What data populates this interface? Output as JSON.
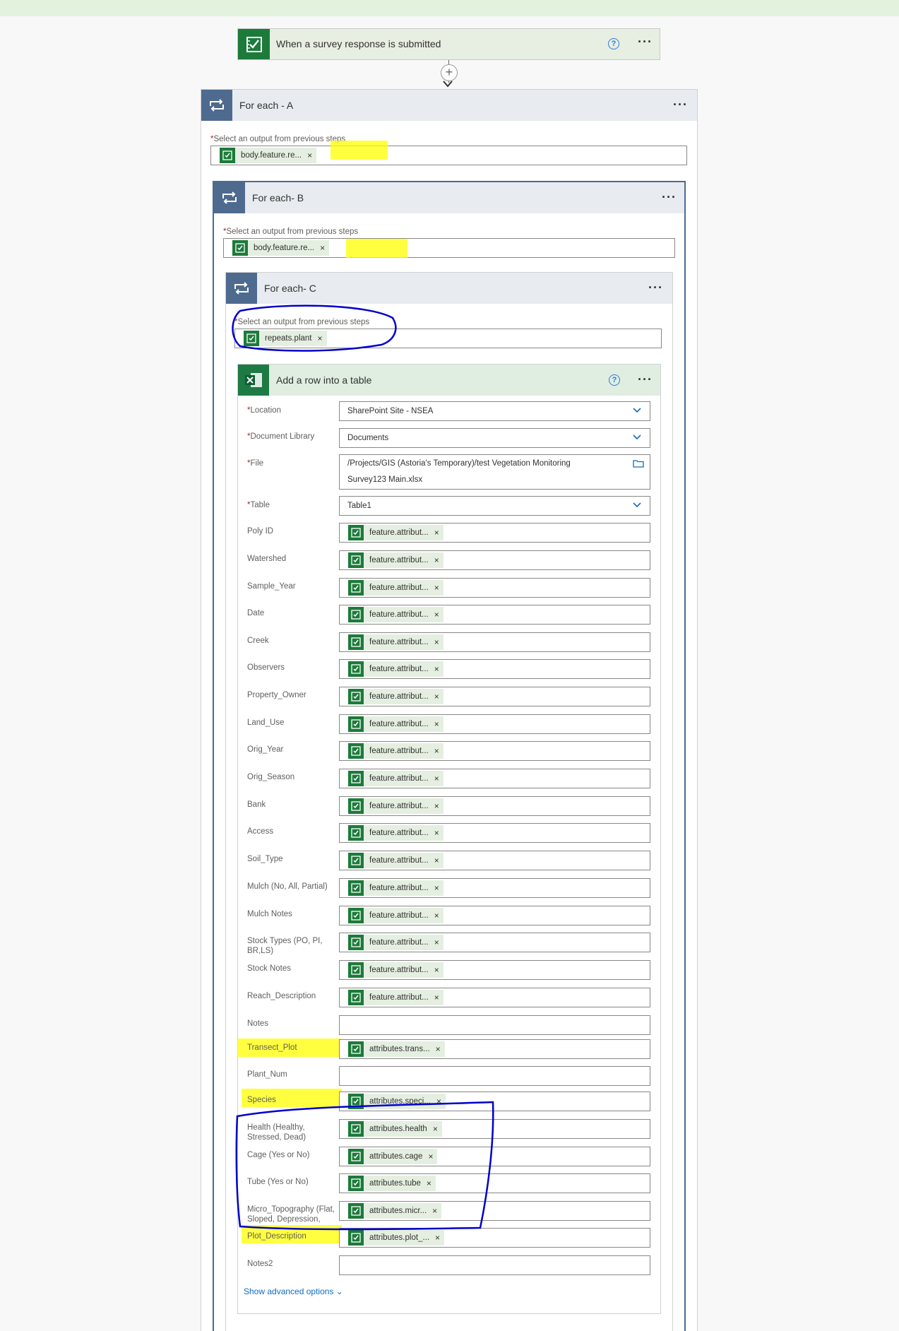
{
  "trigger": {
    "title": "When a survey response is submitted",
    "help_label": "?",
    "more_label": "···"
  },
  "loop_a": {
    "title": "For each - A",
    "select_label": "Select an output from previous steps",
    "token": "body.feature.re...",
    "more_label": "···"
  },
  "loop_b": {
    "title": "For each- B",
    "select_label": "Select an output from previous steps",
    "token": "body.feature.re...",
    "more_label": "···"
  },
  "loop_c": {
    "title": "For each- C",
    "select_label": "Select an output from previous steps",
    "token": "repeats.plant",
    "more_label": "···"
  },
  "action": {
    "title": "Add a row into a table",
    "help_label": "?",
    "more_label": "···",
    "location": {
      "label": "Location",
      "value": "SharePoint Site - NSEA"
    },
    "library": {
      "label": "Document Library",
      "value": "Documents"
    },
    "file": {
      "label": "File",
      "line1": "/Projects/GIS (Astoria's Temporary)/test Vegetation Monitoring",
      "line2": "Survey123 Main.xlsx"
    },
    "table": {
      "label": "Table",
      "value": "Table1"
    },
    "rows": [
      {
        "label": "Poly ID",
        "token": "feature.attribut..."
      },
      {
        "label": "Watershed",
        "token": "feature.attribut..."
      },
      {
        "label": "Sample_Year",
        "token": "feature.attribut..."
      },
      {
        "label": "Date",
        "token": "feature.attribut..."
      },
      {
        "label": "Creek",
        "token": "feature.attribut..."
      },
      {
        "label": "Observers",
        "token": "feature.attribut..."
      },
      {
        "label": "Property_Owner",
        "token": "feature.attribut..."
      },
      {
        "label": "Land_Use",
        "token": "feature.attribut..."
      },
      {
        "label": "Orig_Year",
        "token": "feature.attribut..."
      },
      {
        "label": "Orig_Season",
        "token": "feature.attribut..."
      },
      {
        "label": "Bank",
        "token": "feature.attribut..."
      },
      {
        "label": "Access",
        "token": "feature.attribut..."
      },
      {
        "label": "Soil_Type",
        "token": "feature.attribut..."
      },
      {
        "label": "Mulch (No, All, Partial)",
        "token": "feature.attribut..."
      },
      {
        "label": "Mulch Notes",
        "token": "feature.attribut..."
      },
      {
        "label": "Stock Types (PO, PI, BR,LS)",
        "token": "feature.attribut..."
      },
      {
        "label": "Stock Notes",
        "token": "feature.attribut..."
      },
      {
        "label": "Reach_Description",
        "token": "feature.attribut..."
      },
      {
        "label": "Notes",
        "token": ""
      },
      {
        "label": "Transect_Plot",
        "token": "attributes.trans..."
      },
      {
        "label": "Plant_Num",
        "token": ""
      },
      {
        "label": "Species",
        "token": "attributes.speci..."
      },
      {
        "label": "Health (Healthy, Stressed, Dead)",
        "token": "attributes.health"
      },
      {
        "label": "Cage (Yes or No)",
        "token": "attributes.cage"
      },
      {
        "label": "Tube (Yes or No)",
        "token": "attributes.tube"
      },
      {
        "label": "Micro_Topography (Flat, Sloped, Depression,",
        "token": "attributes.micr..."
      },
      {
        "label": "Plot_Description",
        "token": "attributes.plot_..."
      },
      {
        "label": "Notes2",
        "token": ""
      }
    ],
    "show_advanced": "Show advanced options"
  },
  "colors": {
    "survey_green": "#1c7b3a",
    "loop_blue": "#4e6a8e",
    "excel_green": "#1d7a45",
    "highlight": "#ffff00",
    "annotation": "#0000cc",
    "link": "#0f6cbd"
  }
}
